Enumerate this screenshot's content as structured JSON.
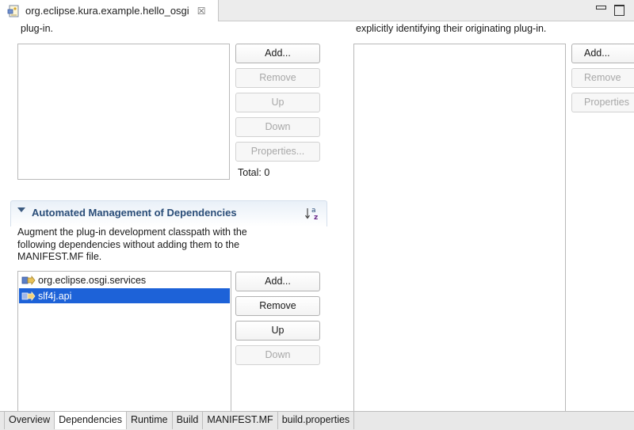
{
  "editor": {
    "tab_title": "org.eclipse.kura.example.hello_osgi",
    "close_glyph": "☒",
    "icon": "plugin-manifest-icon"
  },
  "left_panel": {
    "desc_tail": "plug-in.",
    "buttons": {
      "add": "Add...",
      "remove": "Remove",
      "up": "Up",
      "down": "Down",
      "properties": "Properties..."
    },
    "total_label": "Total: 0"
  },
  "right_panel": {
    "desc_tail": "explicitly identifying their originating plug-in.",
    "buttons": {
      "add": "Add...",
      "remove": "Remove",
      "properties": "Properties"
    }
  },
  "auto_section": {
    "title": "Automated Management of Dependencies",
    "description_lines": [
      "Augment the plug-in development classpath with the",
      "following dependencies without adding them to the",
      "MANIFEST.MF file."
    ],
    "items": [
      {
        "label": "org.eclipse.osgi.services",
        "selected": false
      },
      {
        "label": "slf4j.api",
        "selected": true
      }
    ],
    "buttons": {
      "add": "Add...",
      "remove": "Remove",
      "up": "Up",
      "down": "Down"
    },
    "sort_icon": "sort-alphabetical-icon"
  },
  "page_tabs": [
    {
      "label": "Overview",
      "active": false
    },
    {
      "label": "Dependencies",
      "active": true
    },
    {
      "label": "Runtime",
      "active": false
    },
    {
      "label": "Build",
      "active": false
    },
    {
      "label": "MANIFEST.MF",
      "active": false
    },
    {
      "label": "build.properties",
      "active": false
    }
  ],
  "colors": {
    "selection": "#1d62d8",
    "section_title": "#2a4d78",
    "disabled_text": "#a8a8a8"
  }
}
